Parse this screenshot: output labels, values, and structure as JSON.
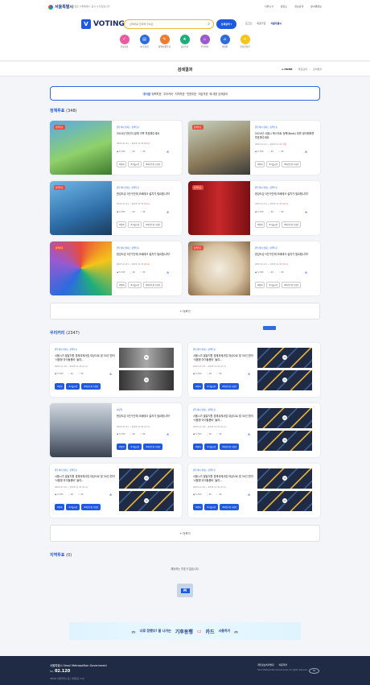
{
  "topbar": {
    "logo": "서울특별시",
    "note": "이 누리집은 서울특별시 공식 누리집입니다.",
    "links": [
      "서울소식",
      "응답소",
      "정보공개",
      "분야별정보"
    ]
  },
  "header": {
    "brand": "VOTING",
    "search_placeholder": "검색어를 입력해 주세요.",
    "adv_button": "상세검색",
    "links": [
      "로그인",
      "회원가입"
    ],
    "seoul_mark": "서울특별시"
  },
  "menu": [
    {
      "label": "투표하기",
      "color": "#ea5aa0",
      "icon": "ballot-icon"
    },
    {
      "label": "내 투표함",
      "color": "#2c6be0",
      "icon": "inbox-icon"
    },
    {
      "label": "정책/민원투표",
      "color": "#f07a30",
      "icon": "policy-icon"
    },
    {
      "label": "공모투표",
      "color": "#1fae7a",
      "icon": "contest-icon"
    },
    {
      "label": "우리커리",
      "color": "#9b59d0",
      "icon": "curry-icon"
    },
    {
      "label": "의결판",
      "color": "#2c6be0",
      "icon": "board-icon"
    },
    {
      "label": "투표만들기",
      "color": "#f5c518",
      "icon": "create-icon"
    }
  ],
  "page": {
    "title": "검색결과",
    "crumbs": [
      "HOME",
      "투표검색",
      "검색결과"
    ]
  },
  "banner": {
    "keyword": "'휴식을'",
    "text": " '정책투표' '우리커리' '지역투표' '민원투표' '여감투표' 에 대한 검색결과"
  },
  "policy": {
    "title": "정책투표",
    "count": "(348)",
    "more": "+ 더보기",
    "cards": [
      {
        "badge": "정책투표",
        "cat": "원투데이 쉽지는 정책투표",
        "title": "2024년 한단지 끝에 가족 투표해주세요",
        "date": "2023.11.21 ~ 2023.11.31",
        "dday": "(D-1)",
        "stats": [
          "5,793",
          "20",
          "30"
        ],
        "tags": [
          "#정책",
          "#서울시민",
          "#의견수렴 기획안"
        ],
        "bg": "linear-gradient(160deg,#5aa9e6 0%,#8fd16a 55%,#3d7a2e 100%)"
      },
      {
        "badge": "정책투표",
        "cat": "원투데이 쉽지는 정책투표",
        "title": "2024년 서울시 북스타트 정책(Book) 부를 생각해하면 투표해주세요",
        "date": "2023.11.21 ~ 2023.11.31",
        "dday": "마감",
        "stats": [
          "5,793",
          "20",
          "30"
        ],
        "tags": [
          "#정책",
          "#서울시민",
          "#의견수렴 기획안"
        ],
        "bg": "linear-gradient(160deg,#c9d3c0 0%,#8a7a5a 60%,#3a3a3a 100%)"
      },
      {
        "badge": "정책투표",
        "cat": "원투데이 쉽지는 정책투표",
        "title": "한강도강 5단구간에 오베테크 설치가 필요합니까?",
        "date": "2023.11.21 ~ 2023.11.31",
        "dday": "(D-1)",
        "stats": [
          "5,793",
          "20",
          "30"
        ],
        "tags": [
          "#정책",
          "#서울시민",
          "#의견수렴 기획안"
        ],
        "bg": "linear-gradient(160deg,#6fb8e8 0%,#2e6ea8 60%,#1b3a5a 100%)"
      },
      {
        "badge": "정책투표",
        "cat": "원투데이 쉽지는 정책투표",
        "title": "한강도강 5단구간에 오베테크 설치가 필요합니까?",
        "date": "2023.11.21 ~ 2023.11.31",
        "dday": "(D-1)",
        "stats": [
          "5,793",
          "20",
          "30"
        ],
        "tags": [
          "#정책",
          "#서울시민",
          "#의견수렴 기획안"
        ],
        "bg": "linear-gradient(90deg,#7a0f12 0%,#c8282a 50%,#7a0f12 100%)"
      },
      {
        "badge": "정책투표",
        "cat": "원투데이 쉽지는 정책투표",
        "title": "한강도강 5단구간에 오베테크 설치가 필요합니까?",
        "date": "2023.11.21 ~ 2023.11.31",
        "dday": "(D-1)",
        "stats": [
          "5,793",
          "20",
          "30"
        ],
        "tags": [
          "#정책",
          "#서울시민",
          "#의견수렴 기획안"
        ],
        "bg": "conic-gradient(#e94b3c,#f5c518,#1fae7a,#2c6be0,#9b59d0,#e94b3c)"
      },
      {
        "badge": "정책투표",
        "cat": "원투데이 쉽지는 정책투표",
        "title": "한강도강 5단구간에 오베테크 설치가 필요합니까?",
        "date": "2023.11.21 ~ 2023.11.31",
        "dday": "(D-1)",
        "stats": [
          "5,793",
          "20",
          "30"
        ],
        "tags": [
          "#정책",
          "#서울시민",
          "#의견수렴 기획안"
        ],
        "bg": "radial-gradient(circle,#f3ece0 0%,#d8c4a4 55%,#8a6a48 100%)"
      }
    ]
  },
  "curry": {
    "title": "우리커리",
    "count": "(2347)",
    "more": "+ 더보기",
    "cards": [
      {
        "cat": "원투데이 쉽지는 정책투표",
        "title": "서울시가 발달지원 경제과제사업 대상으로 할 30인 원의 '서울형 아이돌봄비' 들여…",
        "date": "2023.11.19 ~ 2023.11.31",
        "dday": "(D-1)",
        "stats": [
          "5,793",
          "20",
          "30"
        ],
        "tags": [
          "#정책",
          "#서울시민",
          "#의견수렴 기획안"
        ],
        "thumb": "photo"
      },
      {
        "cat": "원투데이 쉽지는 정책투표",
        "title": "서울시가 발달지원 경제과제사업 대상으로 할 30인 원의 '서울형 아이돌봄비' 들여…",
        "date": "2023.11.19 ~ 2023.11.31",
        "dday": "(D-1)",
        "stats": [
          "5,793",
          "20",
          "30"
        ],
        "tags": [
          "#정책",
          "#서울시민",
          "#의견수렴 기획안"
        ],
        "thumb": "logo"
      },
      {
        "cat": "#정책",
        "title": "한강도강 5단구간에 오베테크 설치가 필요합니까?",
        "date": "2023.11.21 ~ 2023.11.31",
        "dday": "(D-1)",
        "stats": [
          "5,793",
          "20",
          "30"
        ],
        "tags": [
          "#정책",
          "#서울시민",
          "#의견수렴 기획안"
        ],
        "thumb": "plane"
      },
      {
        "cat": "원투데이 쉽지는 정책투표",
        "title": "서울시가 발달지원 경제과제사업 대상으로 할 30인 원의 '서울형 아이돌봄비' 들여…",
        "date": "2023.11.19 ~ 2023.11.31",
        "dday": "(D-1)",
        "stats": [
          "5,793",
          "20",
          "30"
        ],
        "tags": [
          "#정책",
          "#서울시민",
          "#의견수렴 기획안"
        ],
        "thumb": "logo"
      },
      {
        "cat": "원투데이 쉽지는 정책투표",
        "title": "서울시가 발달지원 경제과제사업 대상으로 할 30인 원의 '서울형 아이돌봄비' 들여…",
        "date": "2023.11.19 ~ 2023.11.31",
        "dday": "(D-1)",
        "stats": [
          "5,793",
          "20",
          "30"
        ],
        "tags": [
          "#정책",
          "#서울시민",
          "#의견수렴 기획안"
        ],
        "thumb": "logo"
      },
      {
        "cat": "원투데이 쉽지는 정책투표",
        "title": "서울시가 발달지원 경제과제사업 대상으로 할 30인 원의 '서울형 아이돌봄비' 들여…",
        "date": "2023.11.19 ~ 2023.11.31",
        "dday": "(D-1)",
        "stats": [
          "5,793",
          "20",
          "30"
        ],
        "tags": [
          "#정책",
          "#서울시민",
          "#의견수렴 기획안"
        ],
        "thumb": "logo"
      }
    ]
  },
  "region": {
    "title": "지역투표",
    "count": "(0)",
    "empty": "해당하는 투표가 없습니다."
  },
  "ad": {
    "left": "너로 정했다! 잘 나가는",
    "brand": "기후동행",
    "card": "카드",
    "right": "사용하기"
  },
  "footer": {
    "org": "서울특별시 Seoul Metropolitan Government",
    "tel_prefix": "Tel.",
    "tel": "02.120",
    "address": "04524 서울특별시 중구 세종대로 110",
    "links": [
      "개인정보처리방침",
      "이용약관"
    ],
    "copyright": "Seoul Metropolitan Government. All rights reserved.",
    "wa": "WA"
  }
}
